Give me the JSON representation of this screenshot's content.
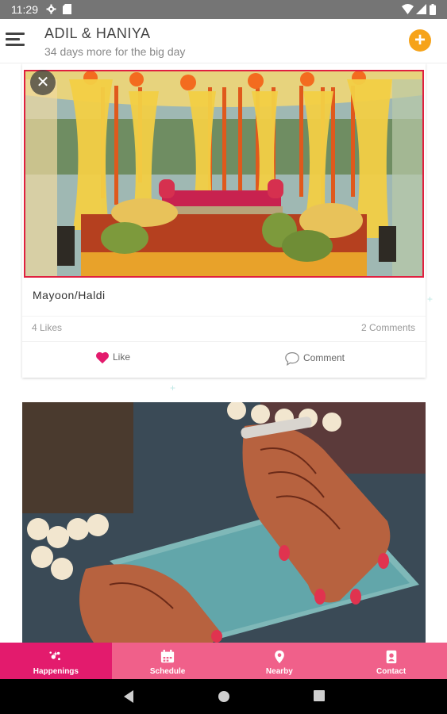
{
  "status_bar": {
    "time": "11:29",
    "icons": [
      "gear-icon",
      "sd-card-icon",
      "wifi-icon",
      "signal-icon",
      "battery-icon"
    ]
  },
  "header": {
    "title": "ADIL & HANIYA",
    "subtitle": "34 days more for the big day",
    "add_icon": "plus-icon",
    "menu_icon": "hamburger-menu-icon",
    "accent_color": "#f6a31a"
  },
  "feed": {
    "posts": [
      {
        "title": "Mayoon/Haldi",
        "likes": "4 Likes",
        "comments": "2 Comments",
        "like_label": "Like",
        "comment_label": "Comment",
        "image": "decorated-mayoon-stage-photo"
      },
      {
        "image": "henna-hands-photo"
      }
    ],
    "like_color": "#e31b6d"
  },
  "tabs": [
    {
      "label": "Happenings",
      "icon": "sparkle-icon",
      "active": true
    },
    {
      "label": "Schedule",
      "icon": "calendar-icon",
      "active": false
    },
    {
      "label": "Nearby",
      "icon": "location-pin-icon",
      "active": false
    },
    {
      "label": "Contact",
      "icon": "contact-card-icon",
      "active": false
    }
  ],
  "colors": {
    "tab_bar": "#f0608a",
    "tab_active": "#e31b6d",
    "image_border": "#e02040"
  },
  "nav_bar": {
    "icons": [
      "back-icon",
      "home-icon",
      "recents-icon"
    ]
  }
}
